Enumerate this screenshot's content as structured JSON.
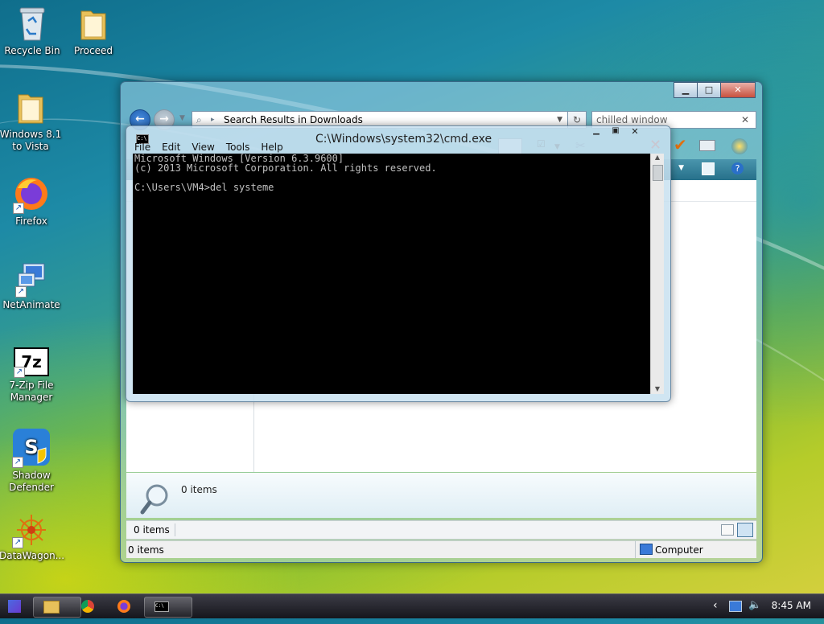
{
  "desktop": {
    "icons": [
      {
        "label": "Recycle Bin"
      },
      {
        "label": "Proceed"
      },
      {
        "label": "Windows 8.1 to Vista"
      },
      {
        "label": "Firefox"
      },
      {
        "label": "NetAnimate"
      },
      {
        "label": "7-Zip File Manager"
      },
      {
        "label": "Shadow Defender"
      },
      {
        "label": "DataWagon..."
      }
    ]
  },
  "explorer": {
    "address": "Search Results in Downloads",
    "search_value": "chilled window",
    "items_count_details": "0 items",
    "items_count_bar": "0 items",
    "status_items": "0 items",
    "status_location": "Computer"
  },
  "cmd": {
    "title": "C:\\Windows\\system32\\cmd.exe",
    "menu": [
      "File",
      "Edit",
      "View",
      "Tools",
      "Help"
    ],
    "lines": [
      "Microsoft Windows [Version 6.3.9600]",
      "(c) 2013 Microsoft Corporation. All rights reserved.",
      "",
      "C:\\Users\\VM4>del systeme"
    ]
  },
  "taskbar": {
    "time": "8:45 AM"
  },
  "colors": {
    "console_bg": "#000000",
    "console_fg": "#c0c0c0",
    "toolbar": "#2f7f97"
  }
}
